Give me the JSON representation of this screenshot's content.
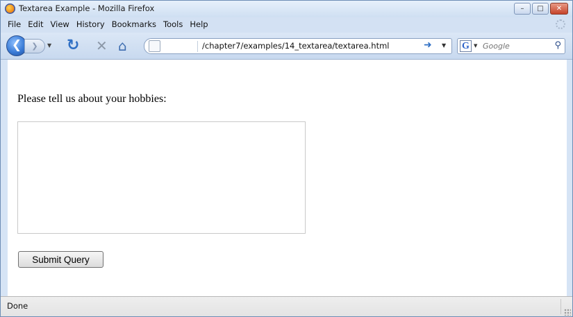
{
  "window": {
    "title": "Textarea Example - Mozilla Firefox",
    "controls": [
      "minimize",
      "maximize",
      "close"
    ]
  },
  "menu": {
    "items": [
      "File",
      "Edit",
      "View",
      "History",
      "Bookmarks",
      "Tools",
      "Help"
    ]
  },
  "toolbar": {
    "url": "/chapter7/examples/14_textarea/textarea.html",
    "search_placeholder": "Google",
    "search_engine_letter": "G",
    "icons": [
      "back-icon",
      "forward-icon",
      "reload-icon",
      "stop-icon",
      "home-icon",
      "go-icon",
      "search-icon"
    ]
  },
  "page": {
    "prompt": "Please tell us about your hobbies:",
    "textarea_value": "",
    "submit_label": "Submit Query"
  },
  "status": {
    "text": "Done"
  },
  "colors": {
    "chrome": "#d6e4f5",
    "accent": "#2f6fc4"
  }
}
